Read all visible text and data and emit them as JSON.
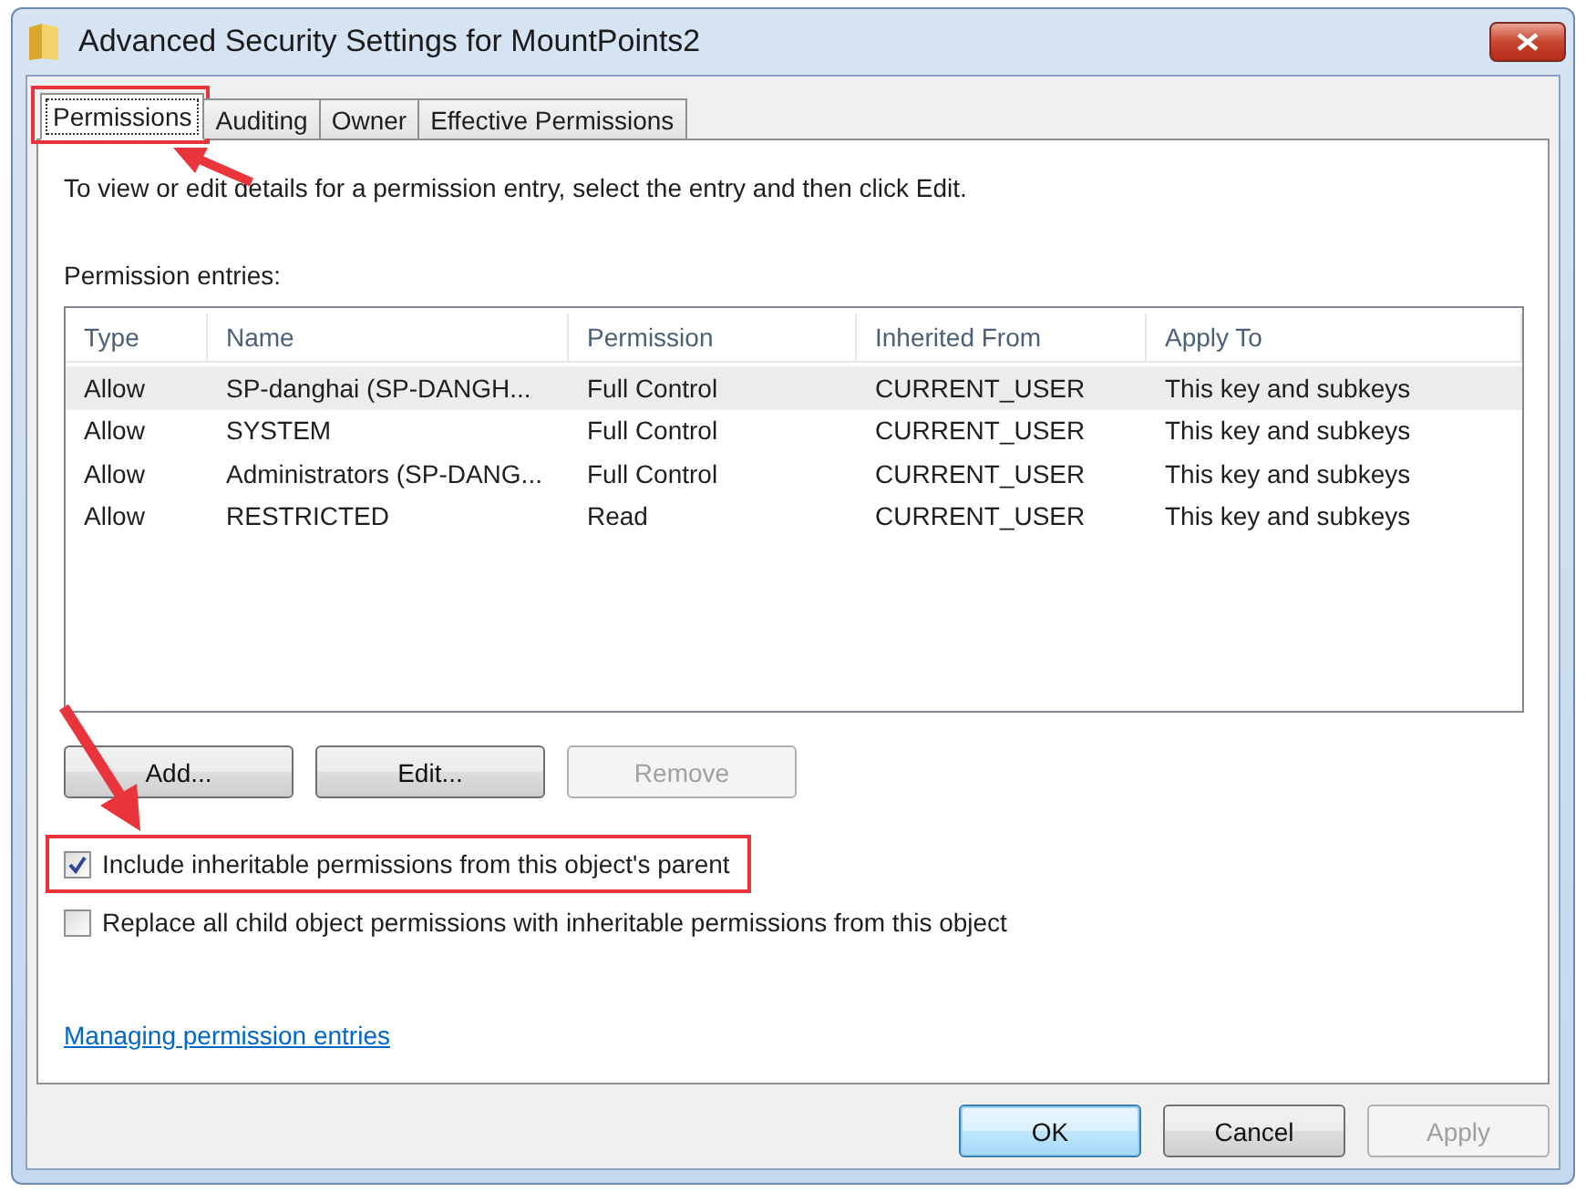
{
  "window": {
    "title": "Advanced Security Settings for MountPoints2"
  },
  "tabs": [
    {
      "label": "Permissions",
      "selected": true,
      "highlighted": true
    },
    {
      "label": "Auditing",
      "selected": false,
      "highlighted": false
    },
    {
      "label": "Owner",
      "selected": false,
      "highlighted": false
    },
    {
      "label": "Effective Permissions",
      "selected": false,
      "highlighted": false
    }
  ],
  "instructions": "To view or edit details for a permission entry, select the entry and then click Edit.",
  "entries_label": "Permission entries:",
  "table": {
    "columns": [
      "Type",
      "Name",
      "Permission",
      "Inherited From",
      "Apply To"
    ],
    "rows": [
      {
        "cells": [
          "Allow",
          "SP-danghai (SP-DANGH...",
          "Full Control",
          "CURRENT_USER",
          "This key and subkeys"
        ],
        "selected": true
      },
      {
        "cells": [
          "Allow",
          "SYSTEM",
          "Full Control",
          "CURRENT_USER",
          "This key and subkeys"
        ],
        "selected": false
      },
      {
        "cells": [
          "Allow",
          "Administrators (SP-DANG...",
          "Full Control",
          "CURRENT_USER",
          "This key and subkeys"
        ],
        "selected": false
      },
      {
        "cells": [
          "Allow",
          "RESTRICTED",
          "Read",
          "CURRENT_USER",
          "This key and subkeys"
        ],
        "selected": false
      }
    ]
  },
  "entry_buttons": [
    {
      "label": "Add...",
      "disabled": false
    },
    {
      "label": "Edit...",
      "disabled": false
    },
    {
      "label": "Remove",
      "disabled": true
    }
  ],
  "checkboxes": [
    {
      "label": "Include inheritable permissions from this object's parent",
      "checked": true,
      "highlighted": true
    },
    {
      "label": "Replace all child object permissions with inheritable permissions from this object",
      "checked": false,
      "highlighted": false
    }
  ],
  "link": "Managing permission entries",
  "dialog_buttons": [
    {
      "label": "OK",
      "disabled": false,
      "default": true
    },
    {
      "label": "Cancel",
      "disabled": false,
      "default": false
    },
    {
      "label": "Apply",
      "disabled": true,
      "default": false
    }
  ]
}
